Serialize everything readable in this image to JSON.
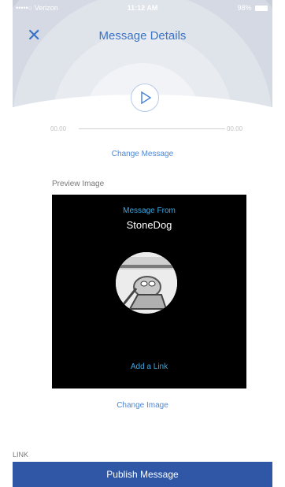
{
  "status_bar": {
    "carrier": "•••••○ Verizon",
    "time": "11:12 AM",
    "battery": "98%"
  },
  "header": {
    "title": "Message Details",
    "close_icon": "close-icon",
    "play_icon": "play-icon"
  },
  "player": {
    "start_time": "00.00",
    "end_time": "00.00",
    "change_message": "Change Message"
  },
  "preview": {
    "label": "Preview Image",
    "message_from": "Message From",
    "sender_name": "StoneDog",
    "add_link": "Add a Link",
    "change_image": "Change Image"
  },
  "link_label": "LINK",
  "publish_button": "Publish Message",
  "colors": {
    "accent": "#3b73c6",
    "publish_bar": "#2f57a6",
    "preview_bg": "#000000",
    "preview_link": "#3da9e6"
  }
}
